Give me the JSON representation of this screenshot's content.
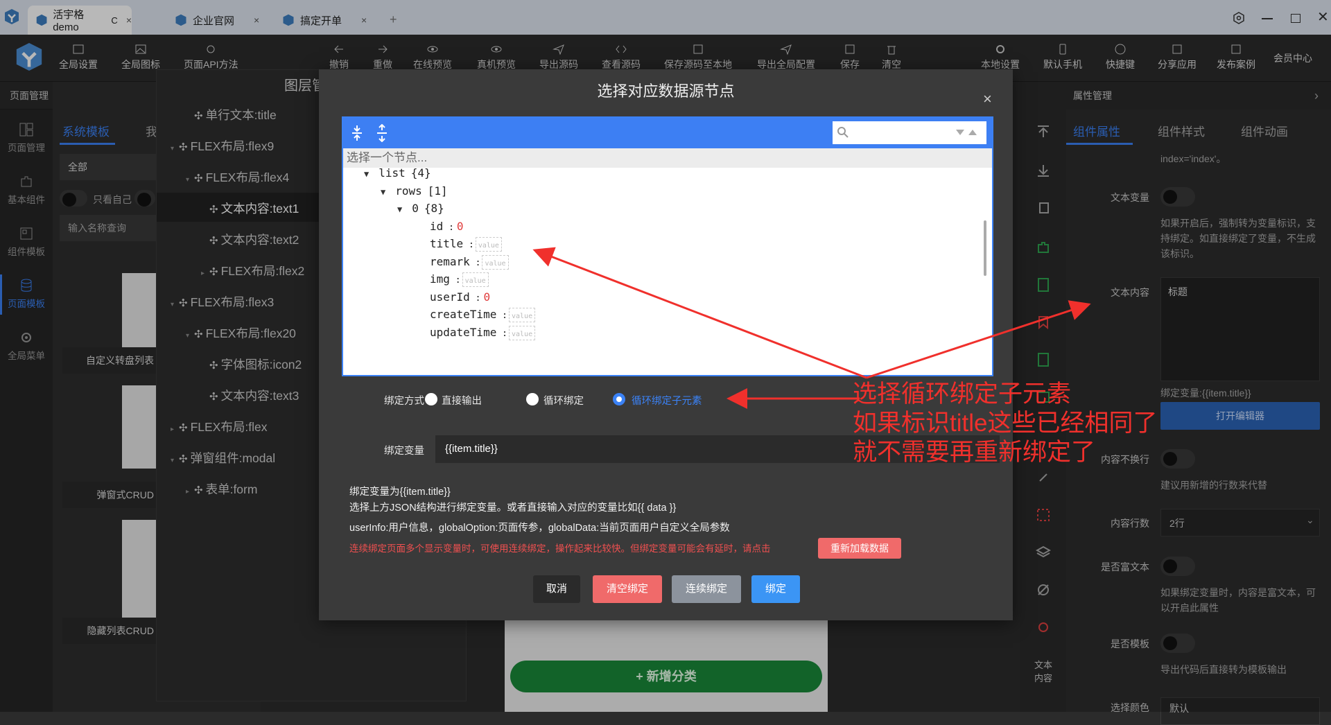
{
  "browser_tabs": [
    {
      "label": "活宇格demo",
      "active": true,
      "reload": "C",
      "close": "×"
    },
    {
      "label": "企业官网",
      "active": false,
      "close": "×"
    },
    {
      "label": "搞定开单",
      "active": false,
      "close": "×"
    }
  ],
  "new_tab": "+",
  "toolbar": [
    {
      "label": "全局设置",
      "icon": "code-window-icon"
    },
    {
      "label": "全局图标",
      "icon": "image-icon"
    },
    {
      "label": "页面API方法",
      "icon": "api-icon"
    },
    {
      "label": "撤销",
      "icon": "undo-icon"
    },
    {
      "label": "重做",
      "icon": "redo-icon"
    },
    {
      "label": "在线预览",
      "icon": "eye-icon"
    },
    {
      "label": "真机预览",
      "icon": "eye-icon"
    },
    {
      "label": "导出源码",
      "icon": "send-icon"
    },
    {
      "label": "查看源码",
      "icon": "code-icon"
    },
    {
      "label": "保存源码至本地",
      "icon": "save-icon"
    },
    {
      "label": "导出全局配置",
      "icon": "send-icon"
    },
    {
      "label": "保存",
      "icon": "save-icon"
    },
    {
      "label": "清空",
      "icon": "trash-icon"
    },
    {
      "label": "本地设置",
      "icon": "gear-icon"
    },
    {
      "label": "默认手机",
      "icon": "phone-icon"
    },
    {
      "label": "快捷键",
      "icon": "help-icon"
    },
    {
      "label": "分享应用",
      "icon": "share-icon"
    },
    {
      "label": "发布案例",
      "icon": "publish-icon"
    },
    {
      "label": "会员中心",
      "icon": ""
    }
  ],
  "left_header": "页面管理",
  "left_nav": [
    {
      "label": "页面管理",
      "icon": "layout-icon"
    },
    {
      "label": "基本组件",
      "icon": "puzzle-icon"
    },
    {
      "label": "组件模板",
      "icon": "template-icon"
    },
    {
      "label": "页面模板",
      "icon": "database-icon",
      "active": true
    },
    {
      "label": "全局菜单",
      "icon": "gear-icon"
    }
  ],
  "left_panel": {
    "tabs": [
      "系统模板",
      "我"
    ],
    "filter": "全部",
    "toggle_label": "只看自己",
    "search_placeholder": "输入名称查询",
    "cards": [
      "自定义转盘列表",
      "弹窗式CRUD",
      "隐藏列表CRUD"
    ]
  },
  "layer_panel": {
    "title": "图层管理",
    "nodes": [
      {
        "label": "单行文本:title",
        "depth": 1,
        "caret": ""
      },
      {
        "label": "FLEX布局:flex9",
        "depth": 0,
        "caret": "▾"
      },
      {
        "label": "FLEX布局:flex4",
        "depth": 1,
        "caret": "▾"
      },
      {
        "label": "文本内容:text1",
        "depth": 2,
        "caret": "",
        "selected": true
      },
      {
        "label": "文本内容:text2",
        "depth": 2,
        "caret": ""
      },
      {
        "label": "FLEX布局:flex2",
        "depth": 2,
        "caret": "▸"
      },
      {
        "label": "FLEX布局:flex3",
        "depth": 0,
        "caret": "▾"
      },
      {
        "label": "FLEX布局:flex20",
        "depth": 1,
        "caret": "▾"
      },
      {
        "label": "字体图标:icon2",
        "depth": 2,
        "caret": ""
      },
      {
        "label": "文本内容:text3",
        "depth": 2,
        "caret": ""
      },
      {
        "label": "FLEX布局:flex",
        "depth": 0,
        "caret": "▸"
      },
      {
        "label": "弹窗组件:modal",
        "depth": 0,
        "caret": "▾"
      },
      {
        "label": "表单:form",
        "depth": 1,
        "caret": "▸"
      }
    ]
  },
  "canvas": {
    "add_button": "+ 新增分类"
  },
  "right_panel": {
    "header": "属性管理",
    "tabs": [
      "组件属性",
      "组件样式",
      "组件动画"
    ],
    "top_text": "index='index'。",
    "text_var_label": "文本变量",
    "text_var_desc": "如果开启后，强制转为变量标识，支持绑定。如直接绑定了变量，不生成该标识。",
    "text_content_label": "文本内容",
    "text_content_value": "标题",
    "bind_var_display": "绑定变量:{{item.title}}",
    "open_editor": "打开编辑器",
    "nowrap_label": "内容不换行",
    "nowrap_desc": "建议用新增的行数来代替",
    "lines_label": "内容行数",
    "lines_value": "2行",
    "rich_label": "是否富文本",
    "rich_desc": "如果绑定变量时，内容是富文本，可以开启此属性",
    "template_label": "是否模板",
    "template_desc": "导出代码后直接转为模板输出",
    "bottom_label": "选择颜色",
    "bottom_value": "默认"
  },
  "right_strip_label": "文本内容",
  "dialog": {
    "title": "选择对应数据源节点",
    "close": "×",
    "hint": "选择一个节点...",
    "tree": [
      {
        "key": "list",
        "suffix": "{4}",
        "indent": 0,
        "tri": "▼"
      },
      {
        "key": "rows",
        "suffix": "[1]",
        "indent": 1,
        "tri": "▼"
      },
      {
        "key": "0",
        "suffix": "{8}",
        "indent": 2,
        "tri": "▼"
      },
      {
        "key": "id",
        "value": "0",
        "indent": 3
      },
      {
        "key": "title",
        "placeholder": "value",
        "indent": 3
      },
      {
        "key": "remark",
        "placeholder": "value",
        "indent": 3
      },
      {
        "key": "img",
        "placeholder": "value",
        "indent": 3
      },
      {
        "key": "userId",
        "value": "0",
        "indent": 3
      },
      {
        "key": "createTime",
        "placeholder": "value",
        "indent": 3
      },
      {
        "key": "updateTime",
        "placeholder": "value",
        "indent": 3
      }
    ],
    "bind_mode_label": "绑定方式",
    "bind_modes": [
      "直接输出",
      "循环绑定",
      "循环绑定子元素"
    ],
    "bind_mode_selected": 2,
    "bind_var_label": "绑定变量",
    "bind_var_value": "{{item.title}}",
    "note1": "绑定变量为{{item.title}}",
    "note2": "选择上方JSON结构进行绑定变量。或者直接输入对应的变量比如{{ data }}",
    "note3": "userInfo:用户信息，globalOption:页面传参，globalData:当前页面用户自定义全局参数",
    "note4": "连续绑定页面多个显示变量时，可使用连续绑定，操作起来比较快。但绑定变量可能会有延时，请点击",
    "reload_button": "重新加载数据",
    "buttons": {
      "cancel": "取消",
      "clear": "清空绑定",
      "continuous": "连续绑定",
      "bind": "绑定"
    }
  },
  "annotation": [
    "选择循环绑定子元素",
    "如果标识title这些已经相同了",
    "就不需要再重新绑定了"
  ],
  "colors": {
    "accent": "#3b82f6",
    "annotation": "#f0302c",
    "danger": "#f06a6a",
    "add_green": "#19893a"
  }
}
